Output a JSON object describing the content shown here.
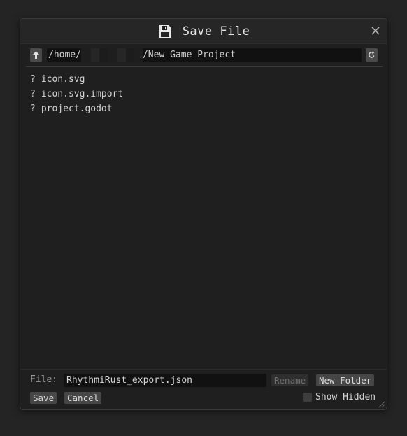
{
  "dialog": {
    "title": "Save File",
    "icons": {
      "title": "floppy-disk-icon",
      "close": "close-icon",
      "up": "arrow-up-icon",
      "refresh": "refresh-icon",
      "resize": "resize-grip-icon"
    }
  },
  "path": {
    "prefix": "/home/",
    "suffix": "/New Game Project"
  },
  "files": [
    {
      "marker": "?",
      "name": "icon.svg"
    },
    {
      "marker": "?",
      "name": "icon.svg.import"
    },
    {
      "marker": "?",
      "name": "project.godot"
    }
  ],
  "footer": {
    "file_label": "File:",
    "file_value": "RhythmiRust_export.json",
    "rename_label": "Rename",
    "new_folder_label": "New Folder",
    "save_label": "Save",
    "cancel_label": "Cancel",
    "show_hidden_label": "Show Hidden",
    "show_hidden_checked": false
  },
  "colors": {
    "background": "#242424",
    "panel": "#1f1f1f",
    "input": "#111111",
    "button": "#464646"
  }
}
